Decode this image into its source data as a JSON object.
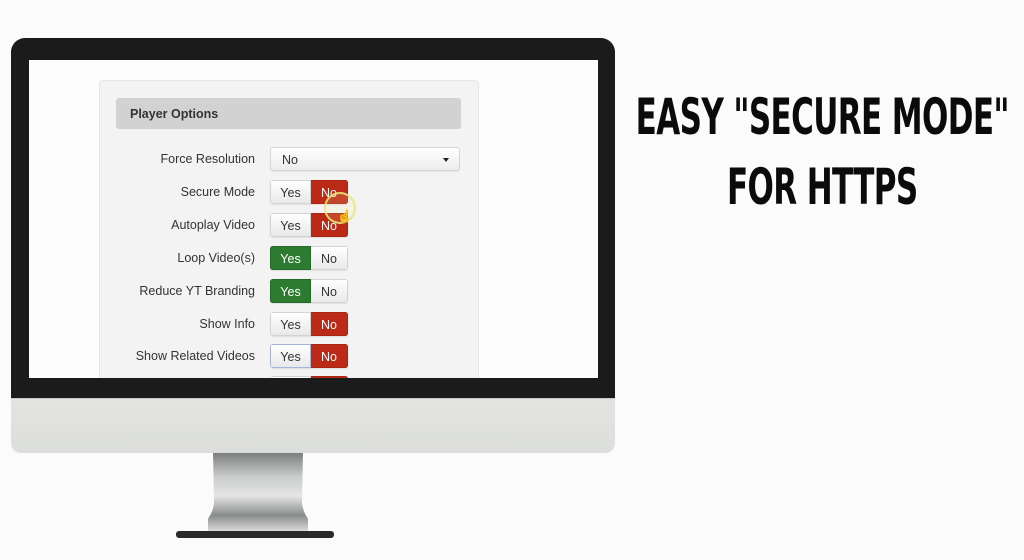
{
  "headline": {
    "line1": "EASY \"SECURE MODE\"",
    "line2": "FOR HTTPS"
  },
  "panel": {
    "title": "Player Options",
    "colors": {
      "no_active": "#bb2a16",
      "yes_active": "#2d7a31",
      "header_bg": "#d2d2d2"
    },
    "force_resolution": {
      "label": "Force Resolution",
      "value": "No"
    },
    "options": [
      {
        "label": "Secure Mode",
        "yes": "Yes",
        "no": "No",
        "selected": "No"
      },
      {
        "label": "Autoplay Video",
        "yes": "Yes",
        "no": "No",
        "selected": "No"
      },
      {
        "label": "Loop Video(s)",
        "yes": "Yes",
        "no": "No",
        "selected": "Yes"
      },
      {
        "label": "Reduce YT Branding",
        "yes": "Yes",
        "no": "No",
        "selected": "Yes"
      },
      {
        "label": "Show Info",
        "yes": "Yes",
        "no": "No",
        "selected": "No"
      },
      {
        "label": "Show Related Videos",
        "yes": "Yes",
        "no": "No",
        "selected": "No"
      }
    ]
  }
}
